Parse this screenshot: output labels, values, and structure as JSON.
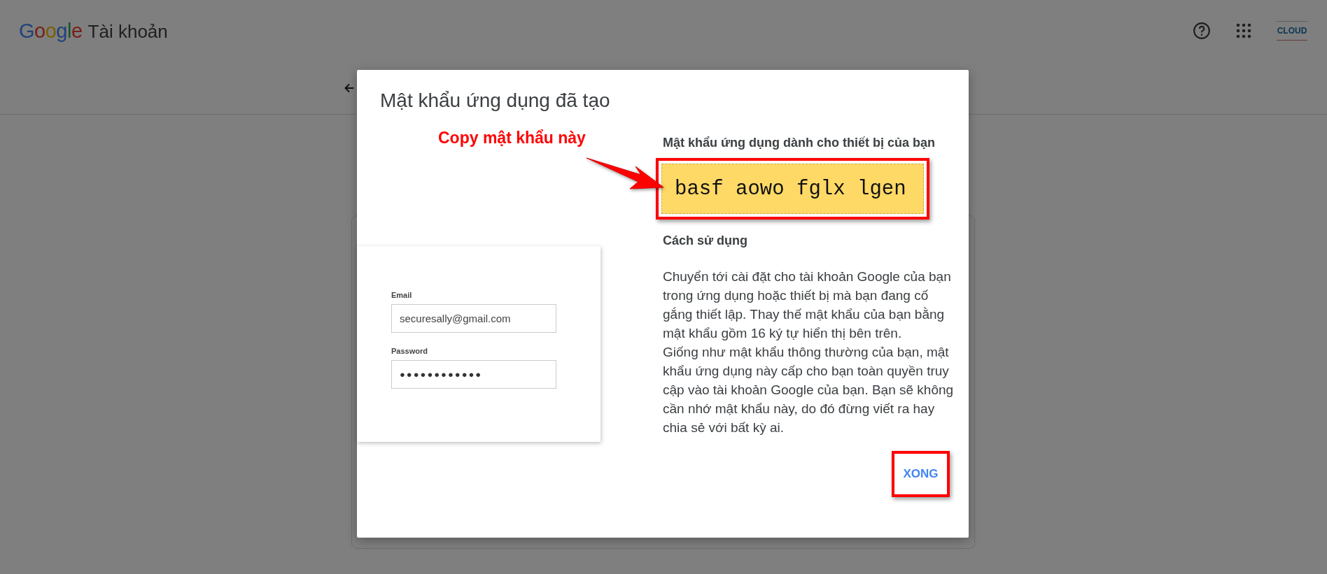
{
  "header": {
    "logo": "Google",
    "product": "Tài khoản",
    "avatar_text": "CLOUD"
  },
  "dialog": {
    "title": "Mật khẩu ứng dụng đã tạo",
    "illustration": {
      "email_label": "Email",
      "email_value": "securesally@gmail.com",
      "password_label": "Password",
      "password_value": "●●●●●●●●●●●●"
    },
    "password_heading": "Mật khẩu ứng dụng dành cho thiết bị của bạn",
    "app_password": "basf aowo fglx lgen",
    "usage_heading": "Cách sử dụng",
    "usage_paragraphs": [
      "Chuyển tới cài đặt cho tài khoản Google của bạn trong ứng dụng hoặc thiết bị mà bạn đang cố gắng thiết lập. Thay thế mật khẩu của bạn bằng mật khẩu gồm 16 ký tự hiển thị bên trên.",
      "Giống như mật khẩu thông thường của bạn, mật khẩu ứng dụng này cấp cho bạn toàn quyền truy cập vào tài khoản Google của bạn. Bạn sẽ không cần nhớ mật khẩu này, do đó đừng viết ra hay chia sẻ với bất kỳ ai."
    ],
    "done_button": "XONG"
  },
  "annotation": {
    "label": "Copy mật khẩu này"
  }
}
